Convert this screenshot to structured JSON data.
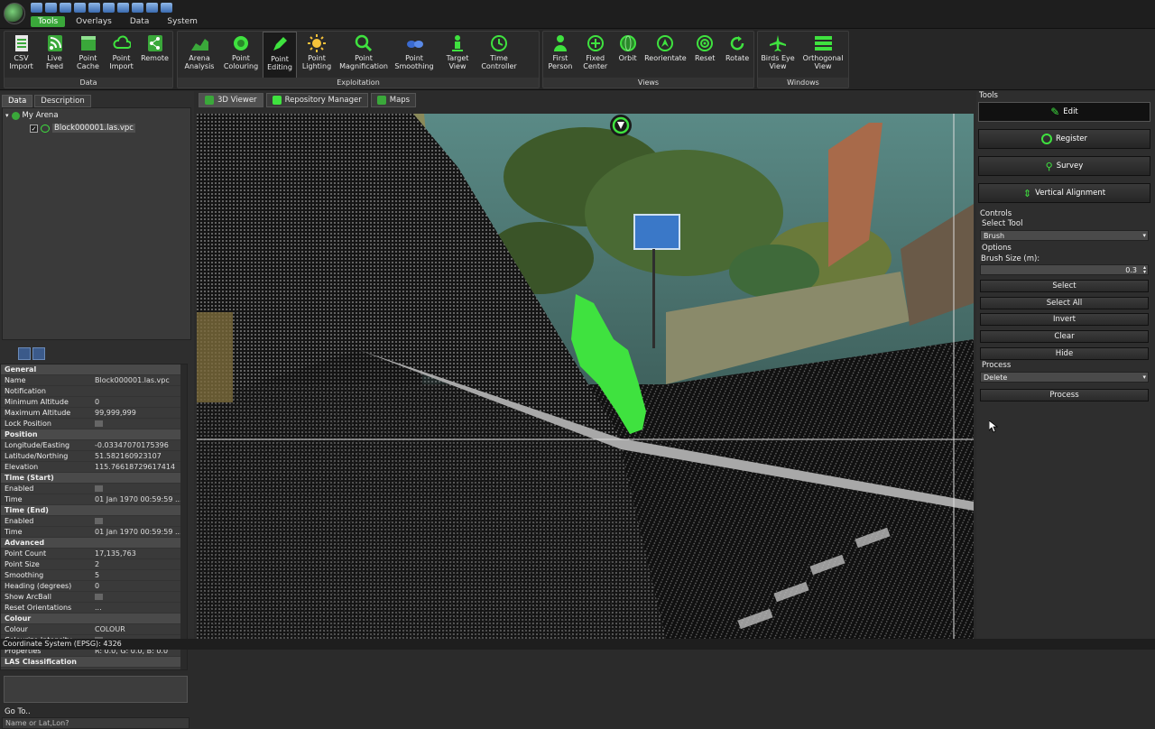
{
  "menu": {
    "tabs": [
      "Tools",
      "Overlays",
      "Data",
      "System"
    ]
  },
  "ribbon": {
    "groups": [
      {
        "title": "Data",
        "buttons": [
          "CSV\nImport",
          "Live\nFeed",
          "Point\nCache",
          "Point\nImport",
          "Remote"
        ]
      },
      {
        "title": "Exploitation",
        "buttons": [
          "Arena\nAnalysis",
          "Point\nColouring",
          "Point\nEditing",
          "Point\nLighting",
          "Point\nMagnification",
          "Point\nSmoothing",
          "Target\nView",
          "Time\nController"
        ]
      },
      {
        "title": "Views",
        "buttons": [
          "First\nPerson",
          "Fixed\nCenter",
          "Orbit",
          "Reorientate",
          "Reset",
          "Rotate"
        ]
      },
      {
        "title": "Windows",
        "buttons": [
          "Birds Eye\nView",
          "Orthogonal\nView"
        ]
      }
    ]
  },
  "left": {
    "tabs": [
      "Data",
      "Description"
    ],
    "tree": {
      "root": "My Arena",
      "child": "Block000001.las.vpc",
      "child_checked": "✓"
    },
    "properties": [
      {
        "section": "General"
      },
      {
        "k": "Name",
        "v": "Block000001.las.vpc"
      },
      {
        "k": "Notification",
        "v": ""
      },
      {
        "k": "Minimum Altitude",
        "v": "0"
      },
      {
        "k": "Maximum Altitude",
        "v": "99,999,999"
      },
      {
        "k": "Lock Position",
        "v": "",
        "swatch": true
      },
      {
        "section": "Position"
      },
      {
        "k": "Longitude/Easting",
        "v": "-0.03347070175396"
      },
      {
        "k": "Latitude/Northing",
        "v": "51.582160923107"
      },
      {
        "k": "Elevation",
        "v": "115.76618729617414"
      },
      {
        "section": "Time (Start)"
      },
      {
        "k": "Enabled",
        "v": "",
        "swatch": true
      },
      {
        "k": "Time",
        "v": "01 Jan 1970 00:59:59 ..."
      },
      {
        "section": "Time (End)"
      },
      {
        "k": "Enabled",
        "v": "",
        "swatch": true
      },
      {
        "k": "Time",
        "v": "01 Jan 1970 00:59:59 ..."
      },
      {
        "section": "Advanced"
      },
      {
        "k": "Point Count",
        "v": "17,135,763"
      },
      {
        "k": "Point Size",
        "v": "2"
      },
      {
        "k": "Smoothing",
        "v": "5"
      },
      {
        "k": "Heading (degrees)",
        "v": "0"
      },
      {
        "k": "Show ArcBall",
        "v": "",
        "swatch": true
      },
      {
        "k": "Reset Orientations",
        "v": "..."
      },
      {
        "section": "Colour"
      },
      {
        "k": "Colour",
        "v": "COLOUR"
      },
      {
        "k": "Colourize Intensity",
        "v": "",
        "swatch": true
      },
      {
        "k": "Properties",
        "v": "R: 0.0, G: 0.0, B: 0.0"
      },
      {
        "section": "LAS Classification"
      }
    ],
    "goto_label": "Go To..",
    "goto_placeholder": "Name or Lat,Lon?"
  },
  "status": {
    "text": "Coordinate System (EPSG): 4326"
  },
  "viewer": {
    "tabs": [
      "3D Viewer",
      "Repository Manager",
      "Maps"
    ]
  },
  "right": {
    "tools_label": "Tools",
    "tools": [
      "Edit",
      "Register",
      "Survey",
      "Vertical Alignment"
    ],
    "controls_label": "Controls",
    "select_tool_label": "Select Tool",
    "select_tool_value": "Brush",
    "options_label": "Options",
    "brush_size_label": "Brush Size (m):",
    "brush_size_value": "0.3",
    "actions": [
      "Select",
      "Select All",
      "Invert",
      "Clear",
      "Hide"
    ],
    "process_label": "Process",
    "process_value": "Delete",
    "process_button": "Process"
  },
  "colors": {
    "accent": "#3aa83a",
    "selection": "#3fe23f",
    "panel": "#2e2e2e"
  }
}
